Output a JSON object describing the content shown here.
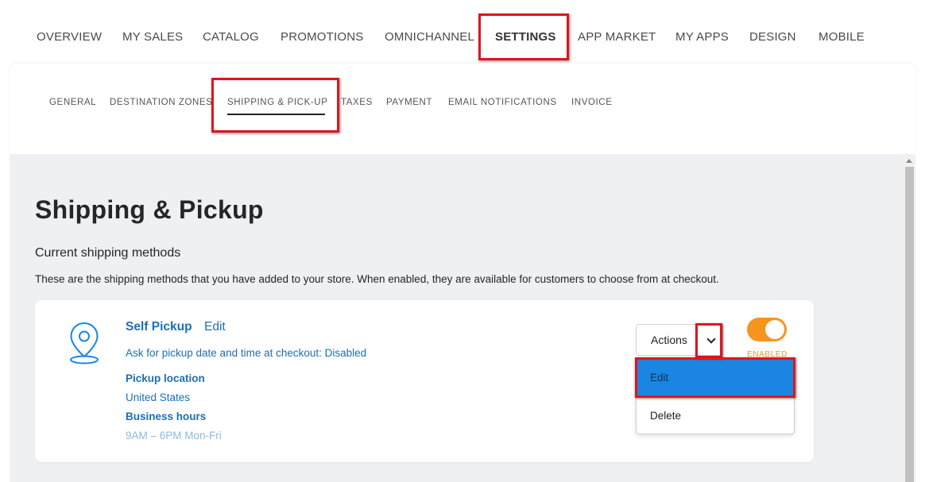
{
  "top_nav": {
    "items": [
      "OVERVIEW",
      "MY SALES",
      "CATALOG",
      "PROMOTIONS",
      "OMNICHANNEL",
      "SETTINGS",
      "APP MARKET",
      "MY APPS",
      "DESIGN",
      "MOBILE"
    ],
    "active": "SETTINGS"
  },
  "sub_tabs": {
    "items": [
      "GENERAL",
      "DESTINATION ZONES",
      "SHIPPING & PICK-UP",
      "TAXES",
      "PAYMENT",
      "EMAIL NOTIFICATIONS",
      "INVOICE"
    ],
    "active": "SHIPPING & PICK-UP"
  },
  "page": {
    "title": "Shipping & Pickup",
    "section_title": "Current shipping methods",
    "section_desc": "These are the shipping methods that you have added to your store. When enabled, they are available for customers to choose from at checkout."
  },
  "method": {
    "icon": "location-pin-icon",
    "name": "Self Pickup",
    "edit_label": "Edit",
    "pickup_setting": "Ask for pickup date and time at checkout: Disabled",
    "location_heading": "Pickup location",
    "location_value": "United States",
    "hours_heading": "Business hours",
    "hours_value": "9AM – 6PM Mon-Fri",
    "actions_label": "Actions",
    "toggle_state": "ENABLED",
    "toggle_on": true
  },
  "actions_menu": {
    "items": [
      "Edit",
      "Delete"
    ],
    "highlighted": "Edit"
  },
  "colors": {
    "accent_blue": "#1c6fb5",
    "toggle_orange": "#f7941d",
    "menu_highlight": "#1a86e2",
    "annotation_red": "#e0151f",
    "content_bg": "#eef0f3"
  }
}
